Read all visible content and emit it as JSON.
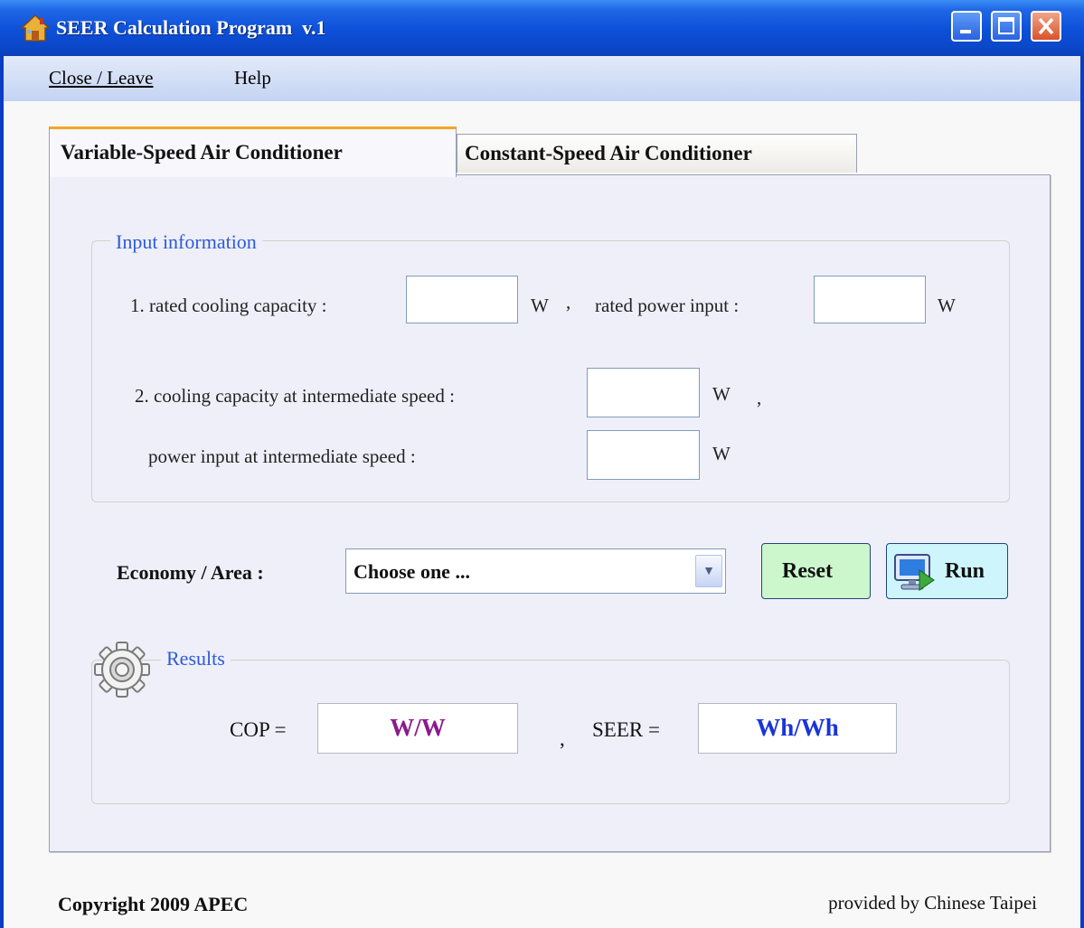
{
  "window": {
    "title": "SEER Calculation Program  v.1"
  },
  "menu": {
    "items": [
      "Close / Leave",
      "Help"
    ]
  },
  "tabs": [
    {
      "label": "Variable-Speed Air Conditioner",
      "active": true
    },
    {
      "label": "Constant-Speed Air Conditioner",
      "active": false
    }
  ],
  "input_group": {
    "legend": "Input information",
    "rated_cooling_capacity_label": "1. rated cooling capacity :",
    "rated_cooling_capacity_value": "",
    "rated_cooling_capacity_unit": "W",
    "separator_1": ",",
    "rated_power_input_label": "rated power input :",
    "rated_power_input_value": "",
    "rated_power_input_unit": "W",
    "intermediate_capacity_label": "2. cooling capacity at intermediate speed :",
    "intermediate_capacity_value": "",
    "intermediate_capacity_unit": "W",
    "separator_2": ",",
    "intermediate_power_label": "power input at intermediate speed :",
    "intermediate_power_value": "",
    "intermediate_power_unit": "W"
  },
  "economy": {
    "label": "Economy / Area :",
    "selected": "Choose one ..."
  },
  "buttons": {
    "reset": "Reset",
    "run": "Run"
  },
  "results": {
    "legend": "Results",
    "cop_label": "COP =",
    "cop_value": "W/W",
    "separator": ",",
    "seer_label": "SEER =",
    "seer_value": "Wh/Wh"
  },
  "footer": {
    "copyright": "Copyright 2009 APEC",
    "provided_by": "provided by Chinese Taipei"
  },
  "colors": {
    "title_bar": "#0b47c8",
    "tab_accent": "#f5a623",
    "legend_text": "#2d5bd6",
    "cop_text": "#8b1a8b",
    "seer_text": "#1a35d6",
    "reset_bg": "#ccf7cc",
    "run_bg": "#cdf5fb"
  }
}
